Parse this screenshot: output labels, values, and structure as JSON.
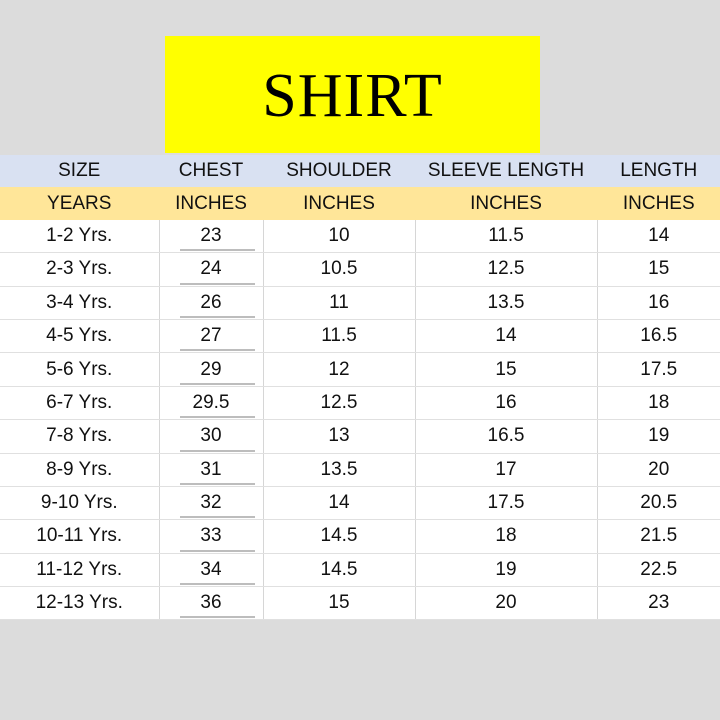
{
  "title": "SHIRT",
  "colors": {
    "title_bg": "#ffff00",
    "header_bg": "#d9e1f2",
    "unit_bg": "#ffe699",
    "page_bg": "#dcdcdc"
  },
  "headers": [
    "SIZE",
    "CHEST",
    "SHOULDER",
    "SLEEVE LENGTH",
    "LENGTH"
  ],
  "units": [
    "YEARS",
    "INCHES",
    "INCHES",
    "INCHES",
    "INCHES"
  ],
  "rows": [
    [
      "1-2 Yrs.",
      "23",
      "10",
      "11.5",
      "14"
    ],
    [
      "2-3 Yrs.",
      "24",
      "10.5",
      "12.5",
      "15"
    ],
    [
      "3-4 Yrs.",
      "26",
      "11",
      "13.5",
      "16"
    ],
    [
      "4-5 Yrs.",
      "27",
      "11.5",
      "14",
      "16.5"
    ],
    [
      "5-6 Yrs.",
      "29",
      "12",
      "15",
      "17.5"
    ],
    [
      "6-7 Yrs.",
      "29.5",
      "12.5",
      "16",
      "18"
    ],
    [
      "7-8 Yrs.",
      "30",
      "13",
      "16.5",
      "19"
    ],
    [
      "8-9 Yrs.",
      "31",
      "13.5",
      "17",
      "20"
    ],
    [
      "9-10 Yrs.",
      "32",
      "14",
      "17.5",
      "20.5"
    ],
    [
      "10-11 Yrs.",
      "33",
      "14.5",
      "18",
      "21.5"
    ],
    [
      "11-12 Yrs.",
      "34",
      "14.5",
      "19",
      "22.5"
    ],
    [
      "12-13 Yrs.",
      "36",
      "15",
      "20",
      "23"
    ]
  ]
}
